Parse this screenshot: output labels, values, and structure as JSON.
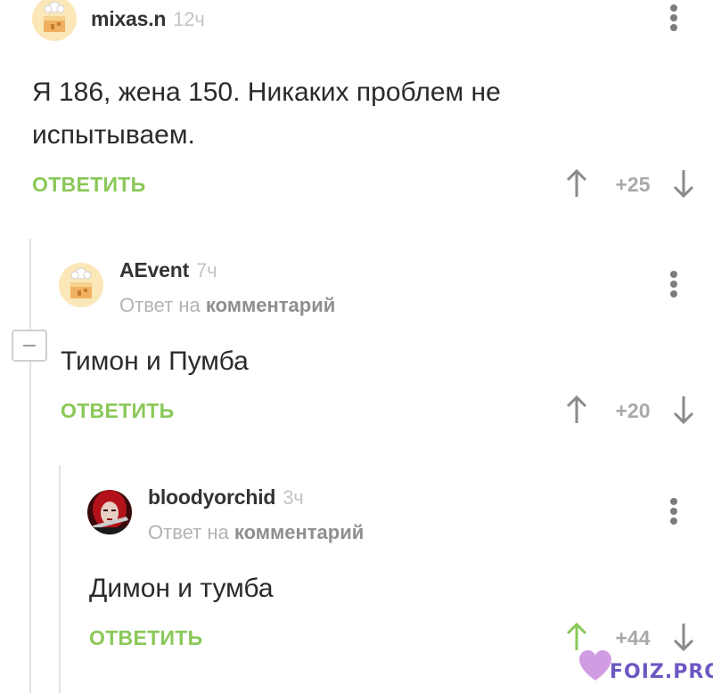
{
  "colors": {
    "reply_green": "#8ac858",
    "meta_gray": "#b3b3b3",
    "thread_line": "#e2e2e2",
    "upvote_active": "#8ac858",
    "arrow_gray": "#8a8a8a"
  },
  "comments": [
    {
      "author": "mixas.n",
      "time": "12ч",
      "avatar": "default-cake-avatar",
      "text_line1": "Я 186, жена 150. Никаких проблем не",
      "text_line2": "испытываем.",
      "reply_label": "ОТВЕТИТЬ",
      "score": "+25",
      "upvoted": false
    },
    {
      "author": "AEvent",
      "time": "7ч",
      "avatar": "default-cake-avatar",
      "reply_to_prefix": "Ответ на",
      "reply_to_link": "комментарий",
      "text": "Тимон и Пумба",
      "reply_label": "ОТВЕТИТЬ",
      "score": "+20",
      "upvoted": false
    },
    {
      "author": "bloodyorchid",
      "time": "3ч",
      "avatar": "red-hair-portrait-avatar",
      "reply_to_prefix": "Ответ на",
      "reply_to_link": "комментарий",
      "text": "Димон и тумба",
      "reply_label": "ОТВЕТИТЬ",
      "score": "+44",
      "upvoted": true
    }
  ],
  "watermark": {
    "text": "FOIZ.PRO",
    "icon": "heart-icon"
  }
}
